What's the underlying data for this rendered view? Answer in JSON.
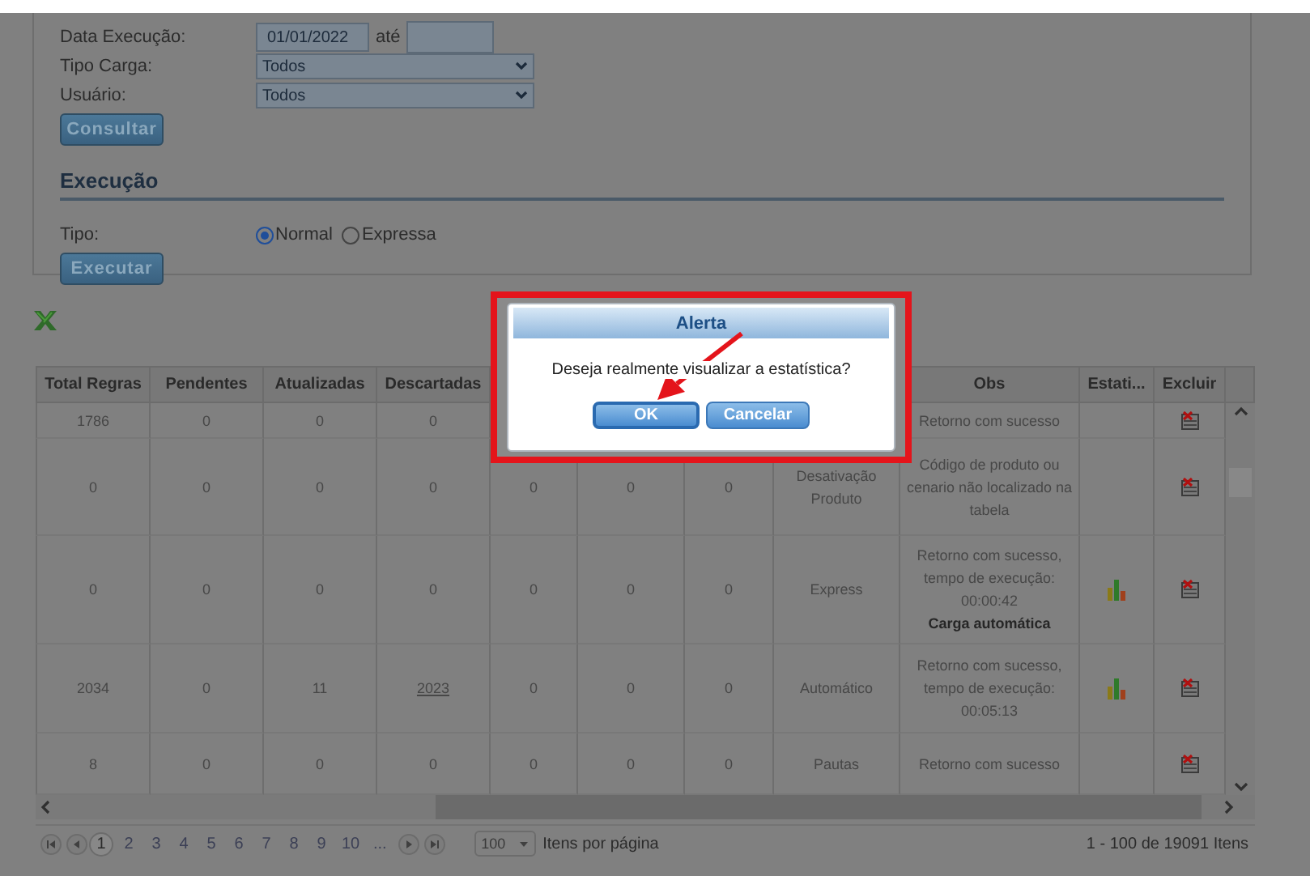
{
  "filters": [
    {
      "kind": "date",
      "label": "Data Execução:",
      "value": "01/01/2022",
      "between": "até"
    },
    {
      "kind": "select",
      "label": "Tipo Carga:",
      "value": "Todos"
    },
    {
      "kind": "select",
      "label": "Usuário:",
      "value": "Todos"
    }
  ],
  "consult_button": "Consultar",
  "execution": {
    "heading": "Execução",
    "type_label": "Tipo:",
    "options": [
      {
        "label": "Normal",
        "selected": true
      },
      {
        "label": "Expressa",
        "selected": false
      }
    ],
    "button": "Executar"
  },
  "table": {
    "columns_left": [
      "Total Regras",
      "Pendentes",
      "Atualizadas",
      "Descartadas"
    ],
    "columns_right": [
      "Obs",
      "Estati...",
      "Excluir"
    ],
    "rows": [
      {
        "cells": [
          "1786",
          "0",
          "0",
          "0"
        ],
        "descartadas_link": false,
        "obs": "Retorno com sucesso",
        "has_chart": false
      },
      {
        "cells": [
          "0",
          "0",
          "0",
          "0",
          "0",
          "0",
          "0",
          "Desativação Produto"
        ],
        "descartadas_link": false,
        "obs": "Código de produto ou cenario não localizado na tabela",
        "has_chart": false
      },
      {
        "cells": [
          "0",
          "0",
          "0",
          "0",
          "0",
          "0",
          "0",
          "Express"
        ],
        "descartadas_link": false,
        "obs": "Retorno com sucesso, tempo de execução: 00:00:42",
        "obs_note": "Carga automática",
        "has_chart": true
      },
      {
        "cells": [
          "2034",
          "0",
          "11",
          "2023",
          "0",
          "0",
          "0",
          "Automático"
        ],
        "descartadas_link": true,
        "obs": "Retorno com sucesso, tempo de execução: 00:05:13",
        "has_chart": true
      },
      {
        "cells": [
          "8",
          "0",
          "0",
          "0",
          "0",
          "0",
          "0",
          "Pautas"
        ],
        "descartadas_link": false,
        "obs": "Retorno com sucesso",
        "has_chart": false
      }
    ]
  },
  "pager": {
    "pages": [
      {
        "label": "1",
        "selected": true
      },
      {
        "label": "2",
        "selected": false
      },
      {
        "label": "3",
        "selected": false
      },
      {
        "label": "4",
        "selected": false
      },
      {
        "label": "5",
        "selected": false
      },
      {
        "label": "6",
        "selected": false
      },
      {
        "label": "7",
        "selected": false
      },
      {
        "label": "8",
        "selected": false
      },
      {
        "label": "9",
        "selected": false
      },
      {
        "label": "10",
        "selected": false
      },
      {
        "label": "...",
        "selected": false
      }
    ],
    "page_size": "100",
    "page_size_label": "Itens por página",
    "summary": "1 - 100 de 19091 Itens"
  },
  "dialog": {
    "title": "Alerta",
    "message": "Deseja realmente visualizar a estatística?",
    "buttons": [
      {
        "label": "OK",
        "selected": true
      },
      {
        "label": "Cancelar",
        "selected": false
      }
    ]
  }
}
